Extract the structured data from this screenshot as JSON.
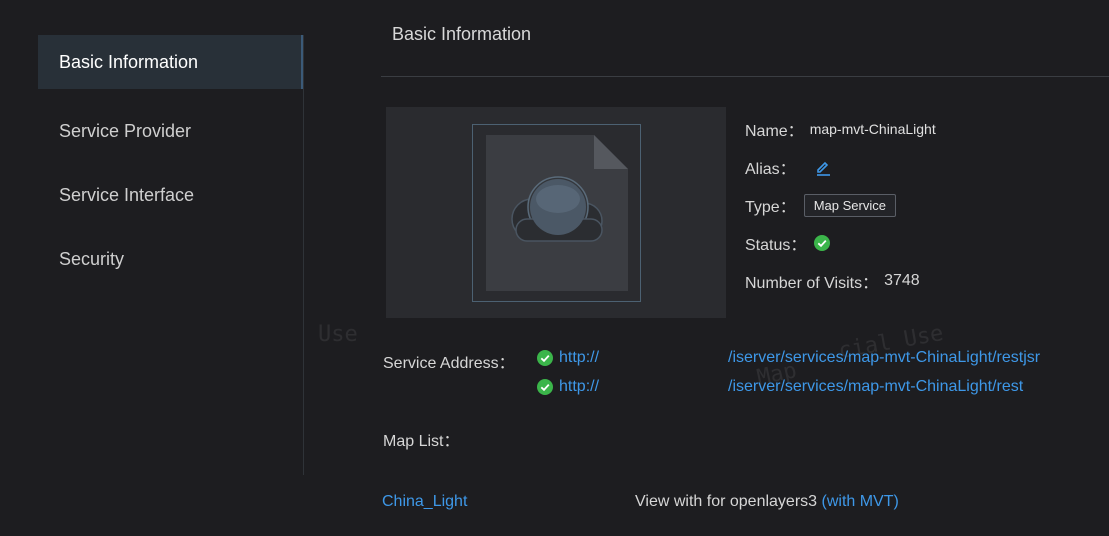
{
  "sidebar": {
    "items": [
      {
        "label": "Basic Information",
        "active": true
      },
      {
        "label": "Service Provider",
        "active": false
      },
      {
        "label": "Service Interface",
        "active": false
      },
      {
        "label": "Security",
        "active": false
      }
    ]
  },
  "main": {
    "title": "Basic Information",
    "info": {
      "name_label": "Name：",
      "name_value": "map-mvt-ChinaLight",
      "alias_label": "Alias：",
      "type_label": "Type：",
      "type_value": "Map Service",
      "status_label": "Status：",
      "visits_label": "Number of Visits：",
      "visits_value": "3748"
    },
    "service_address": {
      "label": "Service Address：",
      "links": [
        {
          "scheme": "http://",
          "path": "/iserver/services/map-mvt-ChinaLight/restjsr"
        },
        {
          "scheme": "http://",
          "path": "/iserver/services/map-mvt-ChinaLight/rest"
        }
      ]
    },
    "map_list": {
      "label": "Map List：",
      "map_name": "China_Light",
      "view_with": "View with",
      "client": "for openlayers3",
      "client_link": "(with MVT)"
    },
    "watermarks": [
      "Use",
      "Map",
      "cial Use"
    ]
  },
  "colors": {
    "background": "#1d1d20",
    "sidebar_active": "#283038",
    "link": "#3e98e8",
    "status_ok": "#3bb54a"
  },
  "icons": {
    "alias_edit": "pencil-icon",
    "status": "check-circle-icon",
    "thumbnail": "cloud-file-icon"
  }
}
